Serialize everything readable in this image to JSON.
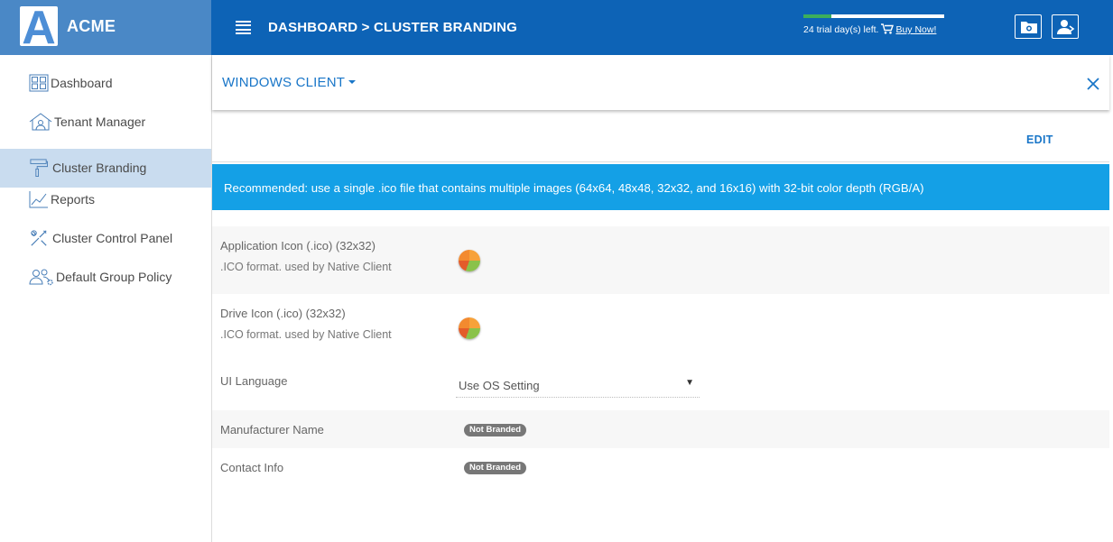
{
  "brand": {
    "logo_letter": "A",
    "name": "ACME"
  },
  "header": {
    "breadcrumb": "DASHBOARD > CLUSTER BRANDING",
    "trial_text": "24 trial day(s) left.",
    "buy_link": "Buy Now!",
    "trial_progress": 0.2
  },
  "sidebar": {
    "items": [
      {
        "label": "Dashboard",
        "icon": "grid-icon"
      },
      {
        "label": "Tenant Manager",
        "icon": "house-icon"
      },
      {
        "label": "Cluster Branding",
        "icon": "paint-roller-icon",
        "active": true
      },
      {
        "label": "Reports",
        "icon": "line-chart-icon"
      },
      {
        "label": "Cluster Control Panel",
        "icon": "tools-icon"
      },
      {
        "label": "Default Group Policy",
        "icon": "users-gear-icon"
      }
    ]
  },
  "main": {
    "client_select": "WINDOWS CLIENT",
    "edit_label": "EDIT",
    "banner": "Recommended: use a single .ico file that contains multiple images (64x64, 48x48, 32x32, and 16x16) with 32-bit color depth (RGB/A)",
    "rows": {
      "app_icon": {
        "label": "Application Icon (.ico) (32x32)",
        "sub": ".ICO format. used by Native Client"
      },
      "drive_icon": {
        "label": "Drive Icon (.ico) (32x32)",
        "sub": ".ICO format. used by Native Client"
      },
      "ui_language": {
        "label": "UI Language",
        "value": "Use OS Setting"
      },
      "manufacturer": {
        "label": "Manufacturer Name",
        "badge": "Not Branded"
      },
      "contact": {
        "label": "Contact Info",
        "badge": "Not Branded"
      }
    }
  },
  "colors": {
    "topbar": "#0d63b6",
    "brand_bg": "#4a88c6",
    "accent": "#1976c8",
    "banner": "#14a0e6",
    "active_nav": "#c9dcef"
  }
}
